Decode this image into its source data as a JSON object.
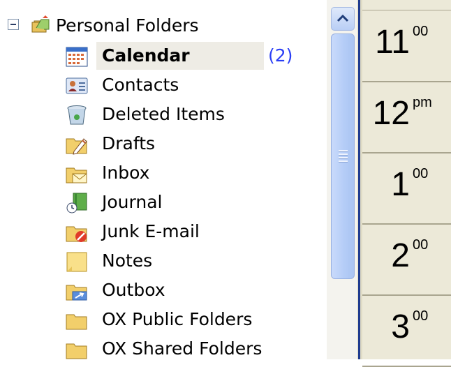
{
  "folder_tree": {
    "root": {
      "label": "Personal Folders",
      "icon": "personal-folders-icon",
      "expanded": true
    },
    "items": [
      {
        "label": "Calendar",
        "icon": "calendar-icon",
        "selected": true,
        "count": "(2)"
      },
      {
        "label": "Contacts",
        "icon": "contacts-icon"
      },
      {
        "label": "Deleted Items",
        "icon": "trash-icon"
      },
      {
        "label": "Drafts",
        "icon": "drafts-icon"
      },
      {
        "label": "Inbox",
        "icon": "inbox-icon"
      },
      {
        "label": "Journal",
        "icon": "journal-icon"
      },
      {
        "label": "Junk E-mail",
        "icon": "junk-email-icon"
      },
      {
        "label": "Notes",
        "icon": "notes-icon"
      },
      {
        "label": "Outbox",
        "icon": "outbox-icon"
      },
      {
        "label": "OX Public Folders",
        "icon": "folder-icon"
      },
      {
        "label": "OX Shared Folders",
        "icon": "folder-icon"
      }
    ]
  },
  "calendar_times": [
    {
      "hour": "11",
      "suffix": "00"
    },
    {
      "hour": "12",
      "suffix": "pm"
    },
    {
      "hour": "1",
      "suffix": "00"
    },
    {
      "hour": "2",
      "suffix": "00"
    },
    {
      "hour": "3",
      "suffix": "00"
    }
  ],
  "colors": {
    "count": "#2a3ef5",
    "selected_background": "#eeece5",
    "calendar_background": "#ece9d8",
    "divider": "#1f3b8f"
  }
}
